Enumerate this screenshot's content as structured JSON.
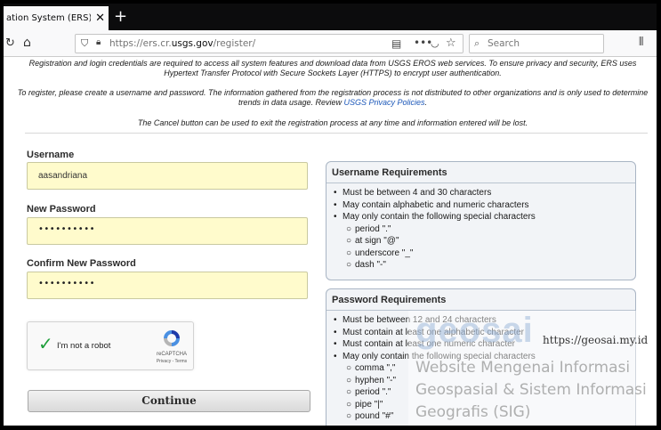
{
  "browser": {
    "tab_title": "ation System (ERS)",
    "tab_close": "✕",
    "new_tab": "+",
    "url_prefix": "https://ers.cr.",
    "url_domain": "usgs.gov",
    "url_path": "/register/",
    "search_placeholder": "Search"
  },
  "intro": {
    "p1_line1": "Registration and login credentials are required to access all system features and download data from USGS EROS web services. To ensure privacy and security, ERS uses",
    "p1_line2": "Hypertext Transfer Protocol with Secure Sockets Layer (HTTPS) to encrypt user authentication.",
    "p2_line1": "To register, please create a username and password. The information gathered from the registration process is not distributed to other organizations and is only used to determine",
    "p2_line2_pre": "trends in data usage. Review ",
    "p2_link": "USGS Privacy Policies",
    "p2_line2_post": ".",
    "p3": "The Cancel button can be used to exit the registration process at any time and information entered will be lost."
  },
  "form": {
    "username_label": "Username",
    "username_value": "aasandriana",
    "new_password_label": "New Password",
    "new_password_value": "••••••••••",
    "confirm_password_label": "Confirm New Password",
    "confirm_password_value": "••••••••••",
    "continue_label": "Continue"
  },
  "recaptcha": {
    "label": "I'm not a robot",
    "brand": "reCAPTCHA",
    "links": "Privacy - Terms"
  },
  "username_requirements": {
    "title": "Username Requirements",
    "items": [
      "Must be between 4 and 30 characters",
      "May contain alphabetic and numeric characters",
      "May only contain the following special characters"
    ],
    "special": [
      "period \".\"",
      "at sign \"@\"",
      "underscore \"_\"",
      "dash \"-\""
    ]
  },
  "password_requirements": {
    "title": "Password Requirements",
    "items": [
      "Must be between 12 and 24 characters",
      "Must contain at least one alphabetic character",
      "Must contain at least one numeric character",
      "May only contain the following special characters"
    ],
    "special": [
      "comma \",\"",
      "hyphen \"-\"",
      "period \".\"",
      "pipe \"|\"",
      "pound \"#\""
    ]
  },
  "watermark": {
    "logo": "geosai",
    "url": "https://geosai.my.id",
    "line1": "Website Mengenai Informasi",
    "line2": "Geospasial & Sistem Informasi",
    "line3": "Geografis (SIG)"
  }
}
